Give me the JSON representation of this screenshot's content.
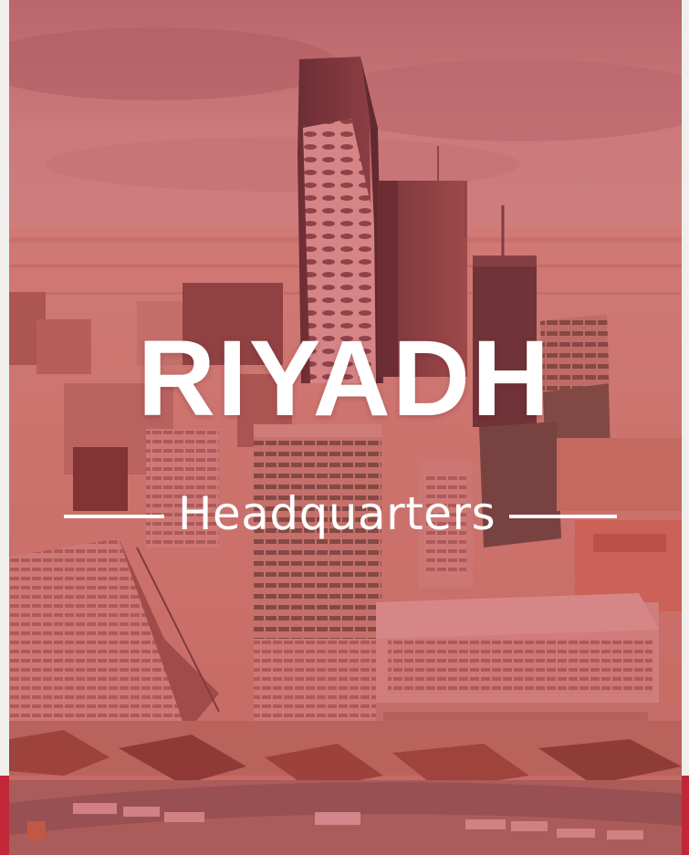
{
  "poster": {
    "city": "RIYADH",
    "tagline": "Headquarters"
  },
  "colors": {
    "tint": "#c42e3c",
    "accent_red": "#c22737",
    "text": "#ffffff",
    "frame": "#f1efeb"
  },
  "image": {
    "subject": "city-skyline-photo"
  }
}
